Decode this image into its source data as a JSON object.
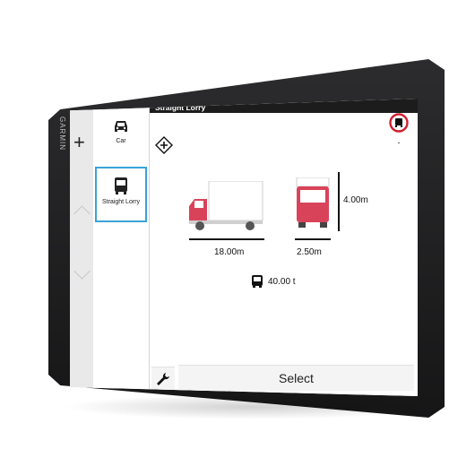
{
  "device": {
    "brand": "GARMIN"
  },
  "screen": {
    "title": "Straight Lorry",
    "left_rail": {
      "add_icon": "plus-icon"
    },
    "vehicle_list": [
      {
        "label": "Car",
        "icon": "car-icon",
        "selected": false
      },
      {
        "label": "Straight Lorry",
        "icon": "lorry-icon",
        "selected": true
      }
    ],
    "dimensions": {
      "length": "18.00m",
      "width": "2.50m",
      "height": "4.00m",
      "weight": "40.00 t"
    },
    "restriction_value": "-",
    "actions": {
      "settings_icon": "wrench-icon",
      "select_label": "Select"
    }
  },
  "colors": {
    "lorry_cab": "#d9435a",
    "selection_border": "#3aa3d6",
    "restriction_ring": "#d11f2f"
  }
}
